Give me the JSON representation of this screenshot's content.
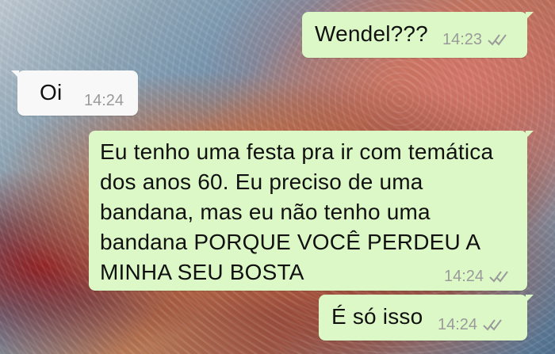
{
  "conversation": {
    "messages": [
      {
        "text": "Wendel???",
        "time": "14:23"
      },
      {
        "text": "Oi",
        "time": "14:24"
      },
      {
        "text": "Eu tenho uma festa pra ir com temática dos anos 60. Eu preciso de uma bandana, mas eu não tenho uma bandana PORQUE VOCÊ PERDEU A MINHA SEU BOSTA",
        "time": "14:24"
      },
      {
        "text": "É só isso",
        "time": "14:24"
      }
    ]
  },
  "theme": {
    "outgoing_bubble": "#dcf8c6",
    "incoming_bubble": "#f8f8f8",
    "timestamp_color": "#9a9a9a"
  },
  "icons": {
    "read_receipt": "double-check-icon"
  }
}
